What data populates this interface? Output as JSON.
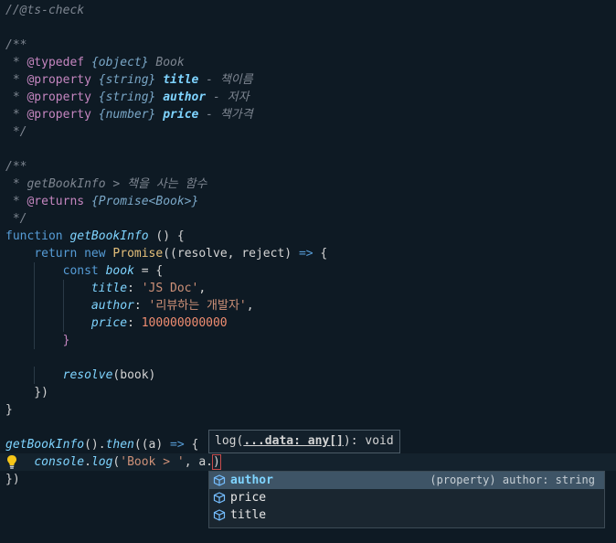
{
  "editor": {
    "lines": [
      {
        "tokens": [
          {
            "t": "//@ts-check",
            "c": "cm"
          }
        ]
      },
      {
        "tokens": []
      },
      {
        "tokens": [
          {
            "t": "/**",
            "c": "cm"
          }
        ]
      },
      {
        "tokens": [
          {
            "t": " * ",
            "c": "cm"
          },
          {
            "t": "@typedef",
            "c": "tag"
          },
          {
            "t": " ",
            "c": "cm"
          },
          {
            "t": "{object}",
            "c": "ty cm"
          },
          {
            "t": " Book",
            "c": "cm"
          }
        ]
      },
      {
        "tokens": [
          {
            "t": " * ",
            "c": "cm"
          },
          {
            "t": "@property",
            "c": "tag"
          },
          {
            "t": " ",
            "c": "cm"
          },
          {
            "t": "{string}",
            "c": "ty cm"
          },
          {
            "t": " ",
            "c": "cm"
          },
          {
            "t": "title",
            "c": "pn"
          },
          {
            "t": " - 책이름",
            "c": "cm"
          }
        ]
      },
      {
        "tokens": [
          {
            "t": " * ",
            "c": "cm"
          },
          {
            "t": "@property",
            "c": "tag"
          },
          {
            "t": " ",
            "c": "cm"
          },
          {
            "t": "{string}",
            "c": "ty cm"
          },
          {
            "t": " ",
            "c": "cm"
          },
          {
            "t": "author",
            "c": "pn"
          },
          {
            "t": " - 저자",
            "c": "cm"
          }
        ]
      },
      {
        "tokens": [
          {
            "t": " * ",
            "c": "cm"
          },
          {
            "t": "@property",
            "c": "tag"
          },
          {
            "t": " ",
            "c": "cm"
          },
          {
            "t": "{number}",
            "c": "ty cm"
          },
          {
            "t": " ",
            "c": "cm"
          },
          {
            "t": "price",
            "c": "pn"
          },
          {
            "t": " - 책가격",
            "c": "cm"
          }
        ]
      },
      {
        "tokens": [
          {
            "t": " */",
            "c": "cm"
          }
        ]
      },
      {
        "tokens": []
      },
      {
        "tokens": [
          {
            "t": "/**",
            "c": "cm"
          }
        ]
      },
      {
        "tokens": [
          {
            "t": " * getBookInfo > 책을 사는 함수",
            "c": "cm"
          }
        ]
      },
      {
        "tokens": [
          {
            "t": " * ",
            "c": "cm"
          },
          {
            "t": "@returns",
            "c": "tag"
          },
          {
            "t": " ",
            "c": "cm"
          },
          {
            "t": "{Promise<Book>}",
            "c": "ty cm"
          }
        ]
      },
      {
        "tokens": [
          {
            "t": " */",
            "c": "cm"
          }
        ]
      },
      {
        "tokens": [
          {
            "t": "function",
            "c": "kw"
          },
          {
            "t": " ",
            "c": "pu"
          },
          {
            "t": "getBookInfo",
            "c": "fn"
          },
          {
            "t": " () {",
            "c": "pu"
          }
        ]
      },
      {
        "tokens": [
          {
            "t": "    ",
            "c": "pu"
          },
          {
            "t": "return",
            "c": "kw"
          },
          {
            "t": " ",
            "c": "pu"
          },
          {
            "t": "new",
            "c": "kw"
          },
          {
            "t": " ",
            "c": "pu"
          },
          {
            "t": "Promise",
            "c": "cls"
          },
          {
            "t": "((resolve, ",
            "c": "pu"
          },
          {
            "t": "reject",
            "c": "prm"
          },
          {
            "t": ") ",
            "c": "pu"
          },
          {
            "t": "=>",
            "c": "kw"
          },
          {
            "t": " {",
            "c": "pu"
          }
        ]
      },
      {
        "tokens": [
          {
            "t": "        ",
            "c": "pu"
          },
          {
            "t": "const",
            "c": "kw"
          },
          {
            "t": " ",
            "c": "pu"
          },
          {
            "t": "book",
            "c": "var"
          },
          {
            "t": " = {",
            "c": "pu"
          }
        ]
      },
      {
        "tokens": [
          {
            "t": "            ",
            "c": "pu"
          },
          {
            "t": "title",
            "c": "prop"
          },
          {
            "t": ": ",
            "c": "pu"
          },
          {
            "t": "'JS Doc'",
            "c": "str"
          },
          {
            "t": ",",
            "c": "pu"
          }
        ]
      },
      {
        "tokens": [
          {
            "t": "            ",
            "c": "pu"
          },
          {
            "t": "author",
            "c": "prop"
          },
          {
            "t": ": ",
            "c": "pu"
          },
          {
            "t": "'리뷰하는 개발자'",
            "c": "str"
          },
          {
            "t": ",",
            "c": "pu"
          }
        ]
      },
      {
        "tokens": [
          {
            "t": "            ",
            "c": "pu"
          },
          {
            "t": "price",
            "c": "prop"
          },
          {
            "t": ": ",
            "c": "pu"
          },
          {
            "t": "100000000000",
            "c": "num"
          }
        ]
      },
      {
        "tokens": [
          {
            "t": "        ",
            "c": "pu"
          },
          {
            "t": "}",
            "c": "op"
          }
        ]
      },
      {
        "tokens": []
      },
      {
        "tokens": [
          {
            "t": "        ",
            "c": "pu"
          },
          {
            "t": "resolve",
            "c": "fn"
          },
          {
            "t": "(book)",
            "c": "pu"
          }
        ]
      },
      {
        "tokens": [
          {
            "t": "    })",
            "c": "pu"
          }
        ]
      },
      {
        "tokens": [
          {
            "t": "}",
            "c": "pu"
          }
        ]
      },
      {
        "tokens": []
      },
      {
        "tokens": [
          {
            "t": "getBookInfo",
            "c": "fn"
          },
          {
            "t": "().",
            "c": "pu"
          },
          {
            "t": "then",
            "c": "fn"
          },
          {
            "t": "((a) ",
            "c": "pu"
          },
          {
            "t": "=>",
            "c": "kw"
          },
          {
            "t": " {",
            "c": "pu"
          }
        ]
      },
      {
        "tokens": [
          {
            "t": "    ",
            "c": "pu"
          },
          {
            "t": "console",
            "c": "var"
          },
          {
            "t": ".",
            "c": "pu"
          },
          {
            "t": "log",
            "c": "fn"
          },
          {
            "t": "(",
            "c": "pu"
          },
          {
            "t": "'Book > '",
            "c": "str"
          },
          {
            "t": ", a.",
            "c": "pu"
          },
          {
            "t": ")",
            "c": "pu cursorbox"
          }
        ],
        "current": true,
        "bulb": true
      },
      {
        "tokens": [
          {
            "t": "})",
            "c": "pu"
          }
        ]
      }
    ]
  },
  "signature_help": {
    "prefix": "log(",
    "param": "...data: any[]",
    "suffix": "): void"
  },
  "suggest": {
    "items": [
      {
        "label": "author",
        "detail": "(property) author: string",
        "icon": "property-cube-icon",
        "selected": true
      },
      {
        "label": "price",
        "detail": "",
        "icon": "property-cube-icon",
        "selected": false
      },
      {
        "label": "title",
        "detail": "",
        "icon": "property-cube-icon",
        "selected": false
      }
    ]
  },
  "colors": {
    "background": "#0e1a24",
    "comment": "#7d8590",
    "keyword": "#569cd6",
    "function": "#7fd4ff",
    "string": "#ce9178",
    "number": "#f08d71",
    "suggest_selected": "#3e5466"
  }
}
